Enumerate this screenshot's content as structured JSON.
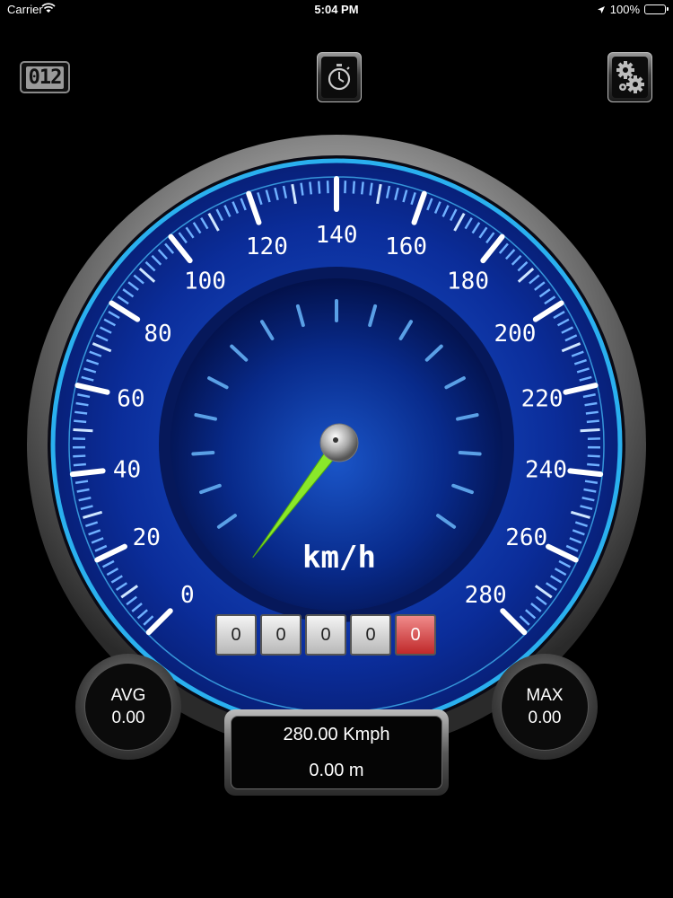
{
  "status_bar": {
    "carrier": "Carrier",
    "time": "5:04 PM",
    "battery": "100%"
  },
  "toolbar": {
    "digit_button_label": "012",
    "timer_icon": "stopwatch-icon",
    "settings_icon": "gears-icon"
  },
  "gauge": {
    "unit": "km/h",
    "scale_labels": [
      "0",
      "20",
      "40",
      "60",
      "80",
      "100",
      "120",
      "140",
      "160",
      "180",
      "200",
      "220",
      "240",
      "260",
      "280"
    ],
    "scale_min": 0,
    "scale_max": 280,
    "needle_value": 0,
    "colors": {
      "dial": "#0a2a8a",
      "ring": "#1ca0e0",
      "needle": "#8ae82a"
    }
  },
  "odometer": {
    "digits": [
      "0",
      "0",
      "0",
      "0",
      "0"
    ]
  },
  "avg": {
    "label": "AVG",
    "value": "0.00"
  },
  "max": {
    "label": "MAX",
    "value": "0.00"
  },
  "readout": {
    "speed": "280.00 Kmph",
    "distance": "0.00 m"
  }
}
